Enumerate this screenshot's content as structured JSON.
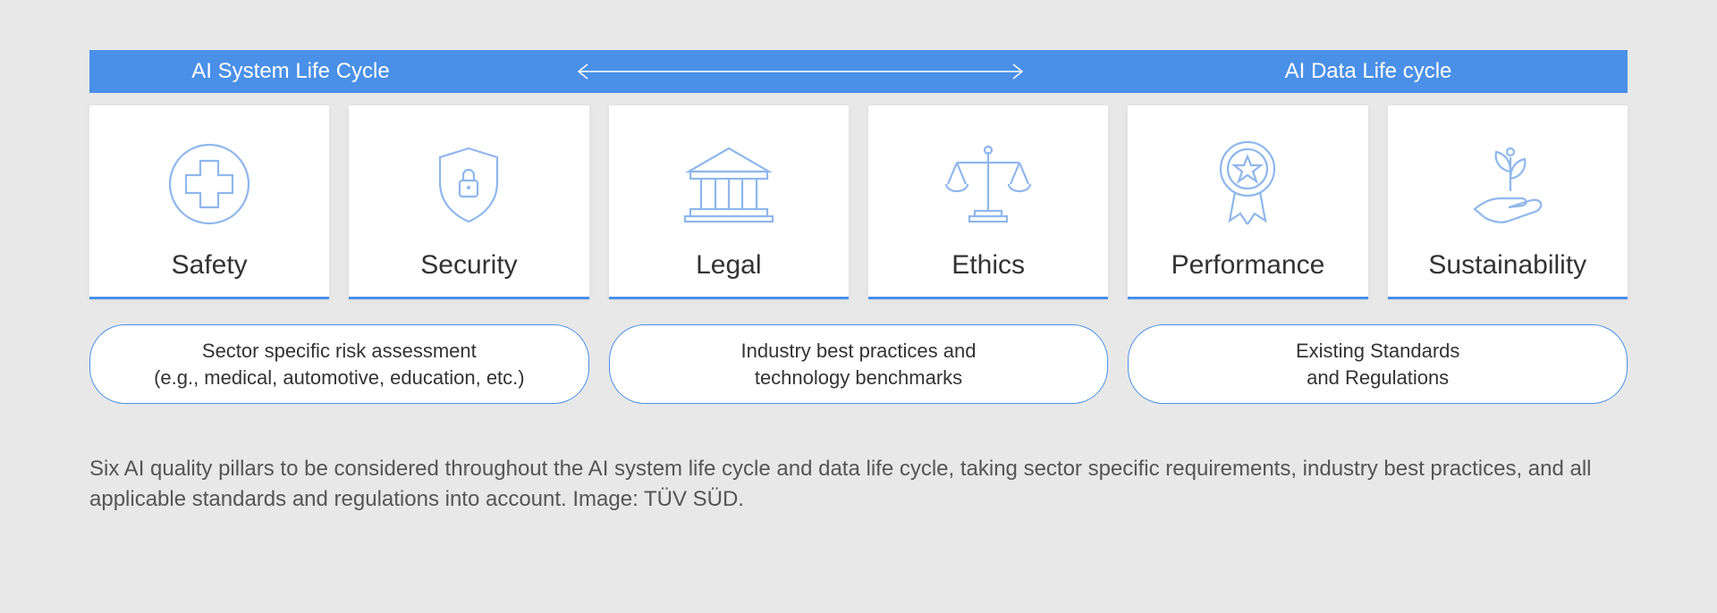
{
  "header": {
    "left": "AI System Life Cycle",
    "right": "AI Data Life cycle"
  },
  "pillars": [
    {
      "id": "safety",
      "label": "Safety"
    },
    {
      "id": "security",
      "label": "Security"
    },
    {
      "id": "legal",
      "label": "Legal"
    },
    {
      "id": "ethics",
      "label": "Ethics"
    },
    {
      "id": "performance",
      "label": "Performance"
    },
    {
      "id": "sustainability",
      "label": "Sustainability"
    }
  ],
  "bubbles": [
    {
      "line1": "Sector specific risk assessment",
      "line2": "(e.g., medical, automotive, education, etc.)"
    },
    {
      "line1": "Industry best practices and",
      "line2": "technology benchmarks"
    },
    {
      "line1": "Existing Standards",
      "line2": "and Regulations"
    }
  ],
  "caption": "Six AI quality pillars to be considered throughout the AI system life cycle and data life cycle, taking sector specific requirements, industry best practices, and all applicable standards and regulations into account. Image: TÜV SÜD."
}
